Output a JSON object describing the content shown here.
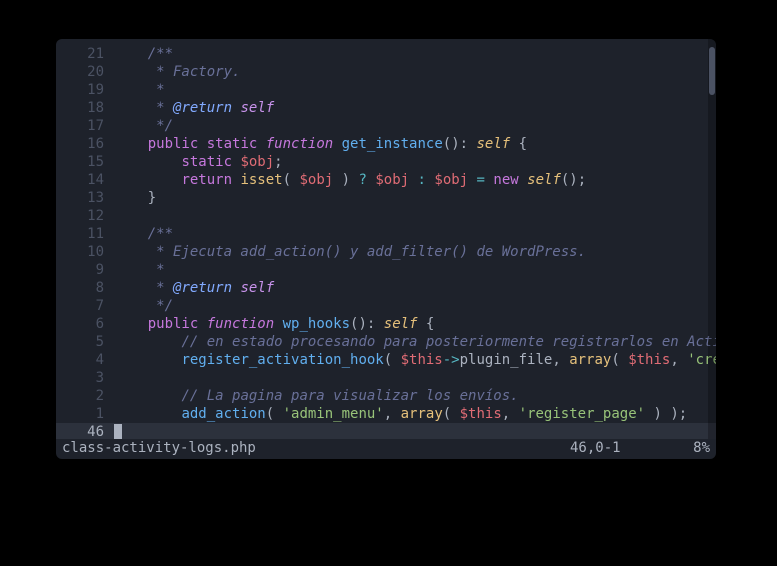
{
  "filename": "class-activity-logs.php",
  "cursor_pos": "46,0-1",
  "percent": "8%",
  "scrollbar": {
    "top_pct": 2,
    "height_pct": 12
  },
  "lines": [
    {
      "rel": "21",
      "current": false,
      "tokens": [
        {
          "cls": "c-plain",
          "txt": "    "
        },
        {
          "cls": "c-doc",
          "txt": "/**"
        }
      ]
    },
    {
      "rel": "20",
      "current": false,
      "tokens": [
        {
          "cls": "c-plain",
          "txt": "    "
        },
        {
          "cls": "c-doc",
          "txt": " * Factory."
        }
      ]
    },
    {
      "rel": "19",
      "current": false,
      "tokens": [
        {
          "cls": "c-plain",
          "txt": "    "
        },
        {
          "cls": "c-doc",
          "txt": " *"
        }
      ]
    },
    {
      "rel": "18",
      "current": false,
      "tokens": [
        {
          "cls": "c-plain",
          "txt": "    "
        },
        {
          "cls": "c-doc",
          "txt": " * "
        },
        {
          "cls": "c-tag",
          "txt": "@return"
        },
        {
          "cls": "c-doc",
          "txt": " "
        },
        {
          "cls": "c-type",
          "txt": "self"
        }
      ]
    },
    {
      "rel": "17",
      "current": false,
      "tokens": [
        {
          "cls": "c-plain",
          "txt": "    "
        },
        {
          "cls": "c-doc",
          "txt": " */"
        }
      ]
    },
    {
      "rel": "16",
      "current": false,
      "tokens": [
        {
          "cls": "c-plain",
          "txt": "    "
        },
        {
          "cls": "c-kw",
          "txt": "public"
        },
        {
          "cls": "c-plain",
          "txt": " "
        },
        {
          "cls": "c-kw",
          "txt": "static"
        },
        {
          "cls": "c-plain",
          "txt": " "
        },
        {
          "cls": "c-kw2",
          "txt": "function"
        },
        {
          "cls": "c-plain",
          "txt": " "
        },
        {
          "cls": "c-fn",
          "txt": "get_instance"
        },
        {
          "cls": "c-punc",
          "txt": "()"
        },
        {
          "cls": "c-punc",
          "txt": ": "
        },
        {
          "cls": "c-self",
          "txt": "self"
        },
        {
          "cls": "c-plain",
          "txt": " "
        },
        {
          "cls": "c-punc",
          "txt": "{"
        }
      ]
    },
    {
      "rel": "15",
      "current": false,
      "tokens": [
        {
          "cls": "c-plain",
          "txt": "        "
        },
        {
          "cls": "c-kw",
          "txt": "static"
        },
        {
          "cls": "c-plain",
          "txt": " "
        },
        {
          "cls": "c-var",
          "txt": "$obj"
        },
        {
          "cls": "c-punc",
          "txt": ";"
        }
      ]
    },
    {
      "rel": "14",
      "current": false,
      "tokens": [
        {
          "cls": "c-plain",
          "txt": "        "
        },
        {
          "cls": "c-kw",
          "txt": "return"
        },
        {
          "cls": "c-plain",
          "txt": " "
        },
        {
          "cls": "c-builtin",
          "txt": "isset"
        },
        {
          "cls": "c-punc",
          "txt": "( "
        },
        {
          "cls": "c-var",
          "txt": "$obj"
        },
        {
          "cls": "c-punc",
          "txt": " ) "
        },
        {
          "cls": "c-op",
          "txt": "?"
        },
        {
          "cls": "c-plain",
          "txt": " "
        },
        {
          "cls": "c-var",
          "txt": "$obj"
        },
        {
          "cls": "c-plain",
          "txt": " "
        },
        {
          "cls": "c-op",
          "txt": ":"
        },
        {
          "cls": "c-plain",
          "txt": " "
        },
        {
          "cls": "c-var",
          "txt": "$obj"
        },
        {
          "cls": "c-plain",
          "txt": " "
        },
        {
          "cls": "c-op",
          "txt": "="
        },
        {
          "cls": "c-plain",
          "txt": " "
        },
        {
          "cls": "c-kw",
          "txt": "new"
        },
        {
          "cls": "c-plain",
          "txt": " "
        },
        {
          "cls": "c-self",
          "txt": "self"
        },
        {
          "cls": "c-punc",
          "txt": "();"
        }
      ]
    },
    {
      "rel": "13",
      "current": false,
      "tokens": [
        {
          "cls": "c-plain",
          "txt": "    "
        },
        {
          "cls": "c-punc",
          "txt": "}"
        }
      ]
    },
    {
      "rel": "12",
      "current": false,
      "tokens": [
        {
          "cls": "c-plain",
          "txt": ""
        }
      ]
    },
    {
      "rel": "11",
      "current": false,
      "tokens": [
        {
          "cls": "c-plain",
          "txt": "    "
        },
        {
          "cls": "c-doc",
          "txt": "/**"
        }
      ]
    },
    {
      "rel": "10",
      "current": false,
      "tokens": [
        {
          "cls": "c-plain",
          "txt": "    "
        },
        {
          "cls": "c-doc",
          "txt": " * Ejecuta add_action() y add_filter() de WordPress."
        }
      ]
    },
    {
      "rel": "9",
      "current": false,
      "tokens": [
        {
          "cls": "c-plain",
          "txt": "    "
        },
        {
          "cls": "c-doc",
          "txt": " *"
        }
      ]
    },
    {
      "rel": "8",
      "current": false,
      "tokens": [
        {
          "cls": "c-plain",
          "txt": "    "
        },
        {
          "cls": "c-doc",
          "txt": " * "
        },
        {
          "cls": "c-tag",
          "txt": "@return"
        },
        {
          "cls": "c-doc",
          "txt": " "
        },
        {
          "cls": "c-type",
          "txt": "self"
        }
      ]
    },
    {
      "rel": "7",
      "current": false,
      "tokens": [
        {
          "cls": "c-plain",
          "txt": "    "
        },
        {
          "cls": "c-doc",
          "txt": " */"
        }
      ]
    },
    {
      "rel": "6",
      "current": false,
      "tokens": [
        {
          "cls": "c-plain",
          "txt": "    "
        },
        {
          "cls": "c-kw",
          "txt": "public"
        },
        {
          "cls": "c-plain",
          "txt": " "
        },
        {
          "cls": "c-kw2",
          "txt": "function"
        },
        {
          "cls": "c-plain",
          "txt": " "
        },
        {
          "cls": "c-fn",
          "txt": "wp_hooks"
        },
        {
          "cls": "c-punc",
          "txt": "()"
        },
        {
          "cls": "c-punc",
          "txt": ": "
        },
        {
          "cls": "c-self",
          "txt": "self"
        },
        {
          "cls": "c-plain",
          "txt": " "
        },
        {
          "cls": "c-punc",
          "txt": "{"
        }
      ]
    },
    {
      "rel": "5",
      "current": false,
      "tokens": [
        {
          "cls": "c-plain",
          "txt": "        "
        },
        {
          "cls": "c-cmt",
          "txt": "// en estado procesando para posteriormente registrarlos en Activi"
        }
      ]
    },
    {
      "rel": "4",
      "current": false,
      "tokens": [
        {
          "cls": "c-plain",
          "txt": "        "
        },
        {
          "cls": "c-fn",
          "txt": "register_activation_hook"
        },
        {
          "cls": "c-punc",
          "txt": "( "
        },
        {
          "cls": "c-var",
          "txt": "$this"
        },
        {
          "cls": "c-op",
          "txt": "->"
        },
        {
          "cls": "c-plain",
          "txt": "plugin_file"
        },
        {
          "cls": "c-punc",
          "txt": ", "
        },
        {
          "cls": "c-builtin",
          "txt": "array"
        },
        {
          "cls": "c-punc",
          "txt": "( "
        },
        {
          "cls": "c-var",
          "txt": "$this"
        },
        {
          "cls": "c-punc",
          "txt": ", "
        },
        {
          "cls": "c-str",
          "txt": "'creat"
        }
      ]
    },
    {
      "rel": "3",
      "current": false,
      "tokens": [
        {
          "cls": "c-plain",
          "txt": ""
        }
      ]
    },
    {
      "rel": "2",
      "current": false,
      "tokens": [
        {
          "cls": "c-plain",
          "txt": "        "
        },
        {
          "cls": "c-cmt",
          "txt": "// La pagina para visualizar los envíos."
        }
      ]
    },
    {
      "rel": "1",
      "current": false,
      "tokens": [
        {
          "cls": "c-plain",
          "txt": "        "
        },
        {
          "cls": "c-fn",
          "txt": "add_action"
        },
        {
          "cls": "c-punc",
          "txt": "( "
        },
        {
          "cls": "c-str",
          "txt": "'admin_menu'"
        },
        {
          "cls": "c-punc",
          "txt": ", "
        },
        {
          "cls": "c-builtin",
          "txt": "array"
        },
        {
          "cls": "c-punc",
          "txt": "( "
        },
        {
          "cls": "c-var",
          "txt": "$this"
        },
        {
          "cls": "c-punc",
          "txt": ", "
        },
        {
          "cls": "c-str",
          "txt": "'register_page'"
        },
        {
          "cls": "c-punc",
          "txt": " ) );"
        }
      ]
    },
    {
      "rel": "46",
      "current": true,
      "tokens": [
        {
          "cls": "cursor",
          "txt": ""
        }
      ]
    }
  ]
}
